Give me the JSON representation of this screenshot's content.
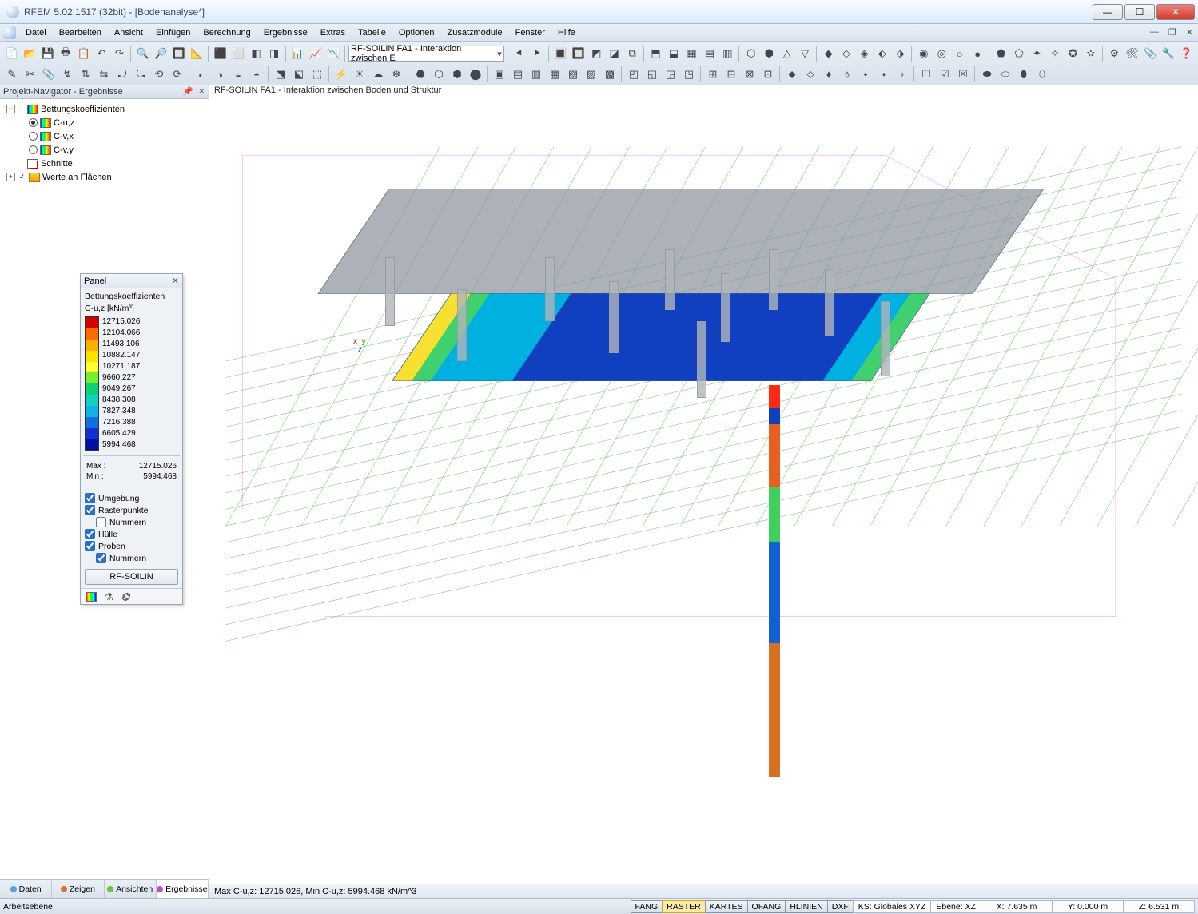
{
  "window": {
    "title": "RFEM 5.02.1517 (32bit) - [Bodenanalyse*]"
  },
  "menu": {
    "items": [
      "Datei",
      "Bearbeiten",
      "Ansicht",
      "Einfügen",
      "Berechnung",
      "Ergebnisse",
      "Extras",
      "Tabelle",
      "Optionen",
      "Zusatzmodule",
      "Fenster",
      "Hilfe"
    ]
  },
  "toolbar": {
    "combo": "RF-SOILIN FA1 - Interaktion zwischen E"
  },
  "navigator": {
    "title": "Projekt-Navigator - Ergebnisse",
    "root": "Bettungskoeffizienten",
    "items": [
      {
        "label": "C-u,z",
        "selected": true
      },
      {
        "label": "C-v,x",
        "selected": false
      },
      {
        "label": "C-v,y",
        "selected": false
      }
    ],
    "schnitte": "Schnitte",
    "werte": "Werte an Flächen",
    "tabs": [
      {
        "label": "Daten"
      },
      {
        "label": "Zeigen"
      },
      {
        "label": "Ansichten"
      },
      {
        "label": "Ergebnisse"
      }
    ]
  },
  "viewport": {
    "title": "RF-SOILIN FA1 - Interaktion zwischen Boden und Struktur",
    "status": "Max C-u,z: 12715.026, Min C-u,z: 5994.468 kN/m^3"
  },
  "panel": {
    "title": "Panel",
    "legend_title": "Bettungskoeffizienten",
    "legend_sub": "C-u,z [kN/m³]",
    "legend": [
      {
        "value": "12715.026",
        "color": "#d40000"
      },
      {
        "value": "12104.066",
        "color": "#ff6a00"
      },
      {
        "value": "11493.106",
        "color": "#ffb000"
      },
      {
        "value": "10882.147",
        "color": "#ffe000"
      },
      {
        "value": "10271.187",
        "color": "#ffff30"
      },
      {
        "value": "9660.227",
        "color": "#70f030"
      },
      {
        "value": "9049.267",
        "color": "#10d070"
      },
      {
        "value": "8438.308",
        "color": "#10d0c0"
      },
      {
        "value": "7827.348",
        "color": "#10b0e8"
      },
      {
        "value": "7216.388",
        "color": "#1070e0"
      },
      {
        "value": "6605.429",
        "color": "#1030d0"
      },
      {
        "value": "5994.468",
        "color": "#0010a0"
      }
    ],
    "max_label": "Max  :",
    "max_value": "12715.026",
    "min_label": "Min  :",
    "min_value": "5994.468",
    "checks": {
      "umgebung": "Umgebung",
      "rasterpunkte": "Rasterpunkte",
      "nummern1": "Nummern",
      "huelle": "Hülle",
      "proben": "Proben",
      "nummern2": "Nummern"
    },
    "button": "RF-SOILIN"
  },
  "statusbar": {
    "left": "Arbeitsebene",
    "toggles": [
      "FANG",
      "RASTER",
      "KARTES",
      "OFANG",
      "HLINIEN",
      "DXF"
    ],
    "ks": "KS: Globales XYZ",
    "ebene": "Ebene: XZ",
    "x": "X: 7.635 m",
    "y": "Y: 0.000 m",
    "z": "Z: 6.531 m"
  },
  "pile_segments": [
    {
      "color": "#ff2810",
      "h": 6
    },
    {
      "color": "#1040c0",
      "h": 4
    },
    {
      "color": "#e86020",
      "h": 16
    },
    {
      "color": "#40d060",
      "h": 14
    },
    {
      "color": "#1060d8",
      "h": 26
    },
    {
      "color": "#d87020",
      "h": 34
    }
  ]
}
